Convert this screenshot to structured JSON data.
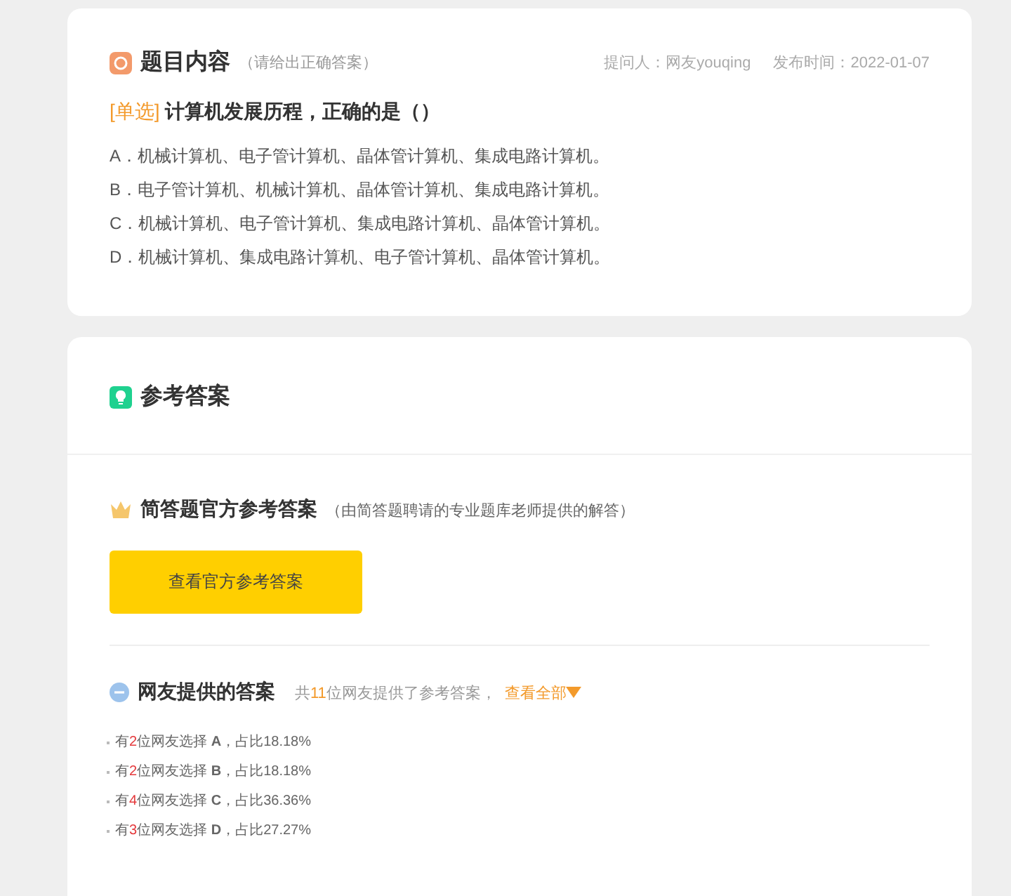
{
  "question_card": {
    "title": "题目内容",
    "hint": "（请给出正确答案）",
    "asker": "提问人：网友youqing",
    "date": "发布时间：2022-01-07",
    "tag": "[单选]",
    "question": "计算机发展历程，正确的是（）",
    "options": [
      "A．机械计算机、电子管计算机、晶体管计算机、集成电路计算机。",
      "B．电子管计算机、机械计算机、晶体管计算机、集成电路计算机。",
      "C．机械计算机、电子管计算机、集成电路计算机、晶体管计算机。",
      "D．机械计算机、集成电路计算机、电子管计算机、晶体管计算机。"
    ]
  },
  "answer_card": {
    "title": "参考答案",
    "official_title": "简答题官方参考答案",
    "official_note": "（由简答题聘请的专业题库老师提供的解答）",
    "official_button": "查看官方参考答案",
    "netizen_title": "网友提供的答案",
    "summary_before": "共",
    "summary_count": "11",
    "summary_after": "位网友提供了参考答案，",
    "view_all": "查看全部",
    "stats": [
      {
        "before": "有",
        "count": "2",
        "middle": "位网友选择",
        "option": "A",
        "after": "，占比18.18%"
      },
      {
        "before": "有",
        "count": "2",
        "middle": "位网友选择",
        "option": "B",
        "after": "，占比18.18%"
      },
      {
        "before": "有",
        "count": "4",
        "middle": "位网友选择",
        "option": "C",
        "after": "，占比36.36%"
      },
      {
        "before": "有",
        "count": "3",
        "middle": "位网友选择",
        "option": "D",
        "after": "，占比27.27%"
      }
    ]
  }
}
